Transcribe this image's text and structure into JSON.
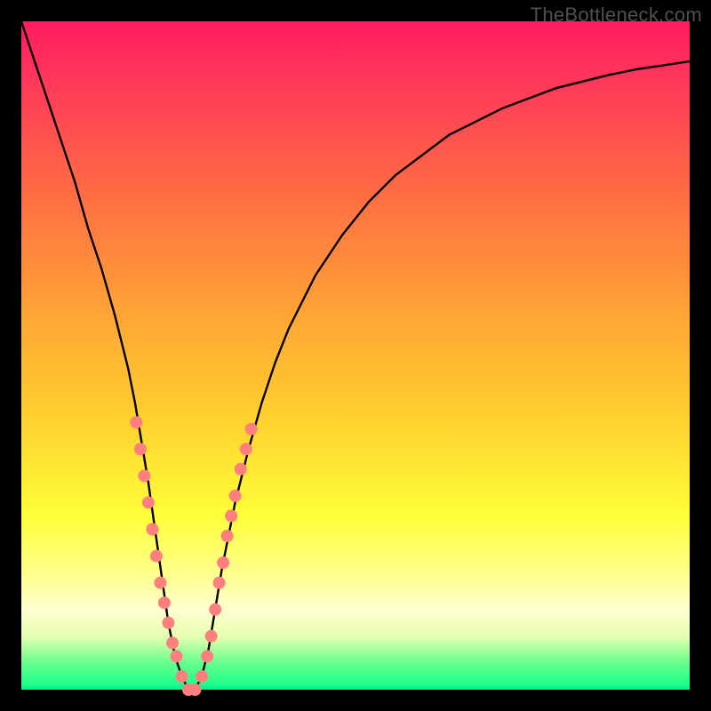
{
  "watermark": "TheBottleneck.com",
  "colors": {
    "frame": "#000000",
    "curve": "#000000",
    "markers": "#ff7f7f",
    "gradient_top": "#ff1a5e",
    "gradient_bottom": "#00f08f"
  },
  "chart_data": {
    "type": "line",
    "title": "",
    "xlabel": "",
    "ylabel": "",
    "xlim": [
      0,
      100
    ],
    "ylim": [
      0,
      100
    ],
    "note": "Axes carry no tick labels; values are read as percentages of the inner plot width/height. y=0 is the green bottom, y=100 is the red top.",
    "series": [
      {
        "name": "bottleneck-curve",
        "x": [
          0,
          2,
          4,
          6,
          8,
          10,
          12,
          14,
          16,
          17,
          18,
          19,
          20,
          21,
          22,
          23,
          24,
          25,
          26,
          27,
          28,
          29,
          30,
          32,
          34,
          36,
          38,
          40,
          44,
          48,
          52,
          56,
          60,
          64,
          68,
          72,
          76,
          80,
          84,
          88,
          92,
          96,
          100
        ],
        "y": [
          100,
          94,
          88,
          82,
          76,
          69,
          63,
          56,
          48,
          43,
          37,
          31,
          24,
          17,
          10,
          5,
          2,
          0,
          0,
          2,
          6,
          12,
          18,
          28,
          36,
          43,
          49,
          54,
          62,
          68,
          73,
          77,
          80,
          83,
          85,
          87,
          88.5,
          90,
          91,
          92,
          92.8,
          93.4,
          94
        ]
      }
    ],
    "markers": {
      "name": "highlighted-points",
      "description": "Pink dots clustered along both walls of the V near the bottom",
      "points": [
        {
          "x": 17.2,
          "y": 40
        },
        {
          "x": 17.8,
          "y": 36
        },
        {
          "x": 18.4,
          "y": 32
        },
        {
          "x": 19.0,
          "y": 28
        },
        {
          "x": 19.6,
          "y": 24
        },
        {
          "x": 20.2,
          "y": 20
        },
        {
          "x": 20.8,
          "y": 16
        },
        {
          "x": 21.4,
          "y": 13
        },
        {
          "x": 22.0,
          "y": 10
        },
        {
          "x": 22.6,
          "y": 7
        },
        {
          "x": 23.2,
          "y": 5
        },
        {
          "x": 24.0,
          "y": 2
        },
        {
          "x": 25.0,
          "y": 0
        },
        {
          "x": 26.0,
          "y": 0
        },
        {
          "x": 27.0,
          "y": 2
        },
        {
          "x": 27.8,
          "y": 5
        },
        {
          "x": 28.4,
          "y": 8
        },
        {
          "x": 29.0,
          "y": 12
        },
        {
          "x": 29.6,
          "y": 16
        },
        {
          "x": 30.2,
          "y": 19
        },
        {
          "x": 30.8,
          "y": 23
        },
        {
          "x": 31.4,
          "y": 26
        },
        {
          "x": 32.0,
          "y": 29
        },
        {
          "x": 32.8,
          "y": 33
        },
        {
          "x": 33.6,
          "y": 36
        },
        {
          "x": 34.4,
          "y": 39
        }
      ]
    }
  }
}
